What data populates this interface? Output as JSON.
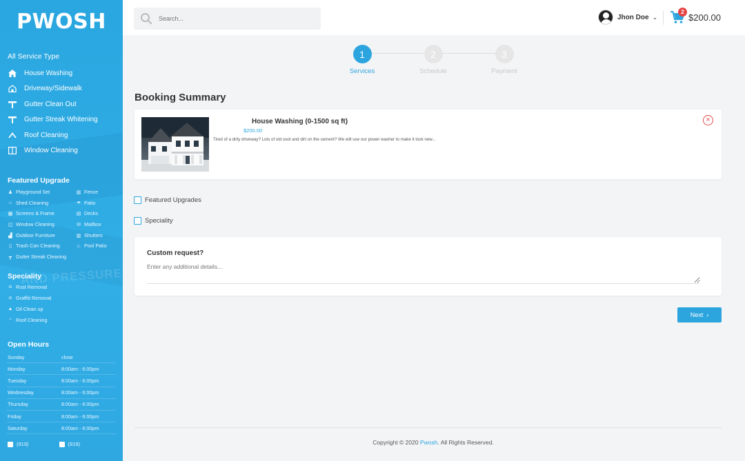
{
  "brand": {
    "logo": "PWOSH",
    "accent": "#2ca5df"
  },
  "sidebar": {
    "service_title": "All Service Type",
    "services": [
      {
        "label": "House Washing",
        "icon": "house-icon"
      },
      {
        "label": "Driveway/Sidewalk",
        "icon": "home-outline-icon"
      },
      {
        "label": "Gutter Clean Out",
        "icon": "gutter-icon"
      },
      {
        "label": "Gutter Streak Whitening",
        "icon": "gutter-icon"
      },
      {
        "label": "Roof Cleaning",
        "icon": "roof-icon"
      },
      {
        "label": "Window Cleaning",
        "icon": "window-icon"
      }
    ],
    "upgrade_title": "Featured Upgrade",
    "upgrades_left": [
      "Playground Set",
      "Shed Cleaning",
      "Screens & Frame",
      "Window Cleaning",
      "Outdoor Furniture",
      "Trash Can Cleaning",
      "Gutter Streak Cleaning"
    ],
    "upgrades_right": [
      "Fence",
      "Patio",
      "Decks",
      "Mailbox",
      "Shutters",
      "Pool Patio"
    ],
    "speciality_title": "Speciality",
    "speciality": [
      "Rust Removal",
      "Graffiti Removal",
      "Oil Clean up",
      "Roof Cleaning"
    ],
    "background_text": "AND PRESSURE",
    "hours_title": "Open Hours",
    "hours": [
      {
        "day": "Sunday",
        "time": "close"
      },
      {
        "day": "Monday",
        "time": "8:00am - 6:00pm"
      },
      {
        "day": "Tuesday",
        "time": "8:00am - 6:00pm"
      },
      {
        "day": "Wednesday",
        "time": "8:00am - 6:00pm"
      },
      {
        "day": "Thursday",
        "time": "8:00am - 6:00pm"
      },
      {
        "day": "Friday",
        "time": "8:00am - 6:00pm"
      },
      {
        "day": "Saturday",
        "time": "8:00am - 6:00pm"
      }
    ],
    "phones": [
      "(919)",
      "(919)"
    ]
  },
  "header": {
    "search_placeholder": "Search...",
    "user_name": "Jhon Doe",
    "cart_count": "2",
    "cart_total": "$200.00"
  },
  "stepper": [
    {
      "num": "1",
      "label": "Services",
      "active": true
    },
    {
      "num": "2",
      "label": "Schedule",
      "active": false
    },
    {
      "num": "3",
      "label": "Payment",
      "active": false
    }
  ],
  "main": {
    "title": "Booking Summary",
    "item": {
      "name": "House Washing (0-1500 sq ft)",
      "price": "$200.00",
      "description": "Tired of a dirty driveway? Lots of old soot and dirt on the cement? We will use our power washer to make it look new..."
    },
    "checks": [
      "Featured Upgrades",
      "Speciality"
    ],
    "custom_title": "Custom request?",
    "custom_placeholder": "Enter any additional details...",
    "next_label": "Next",
    "next_icon": "chevron-right-icon"
  },
  "footer": {
    "prefix": "Copyright © 2020 ",
    "brand": "Pwosh",
    "suffix": ". All Rights Reserved."
  }
}
